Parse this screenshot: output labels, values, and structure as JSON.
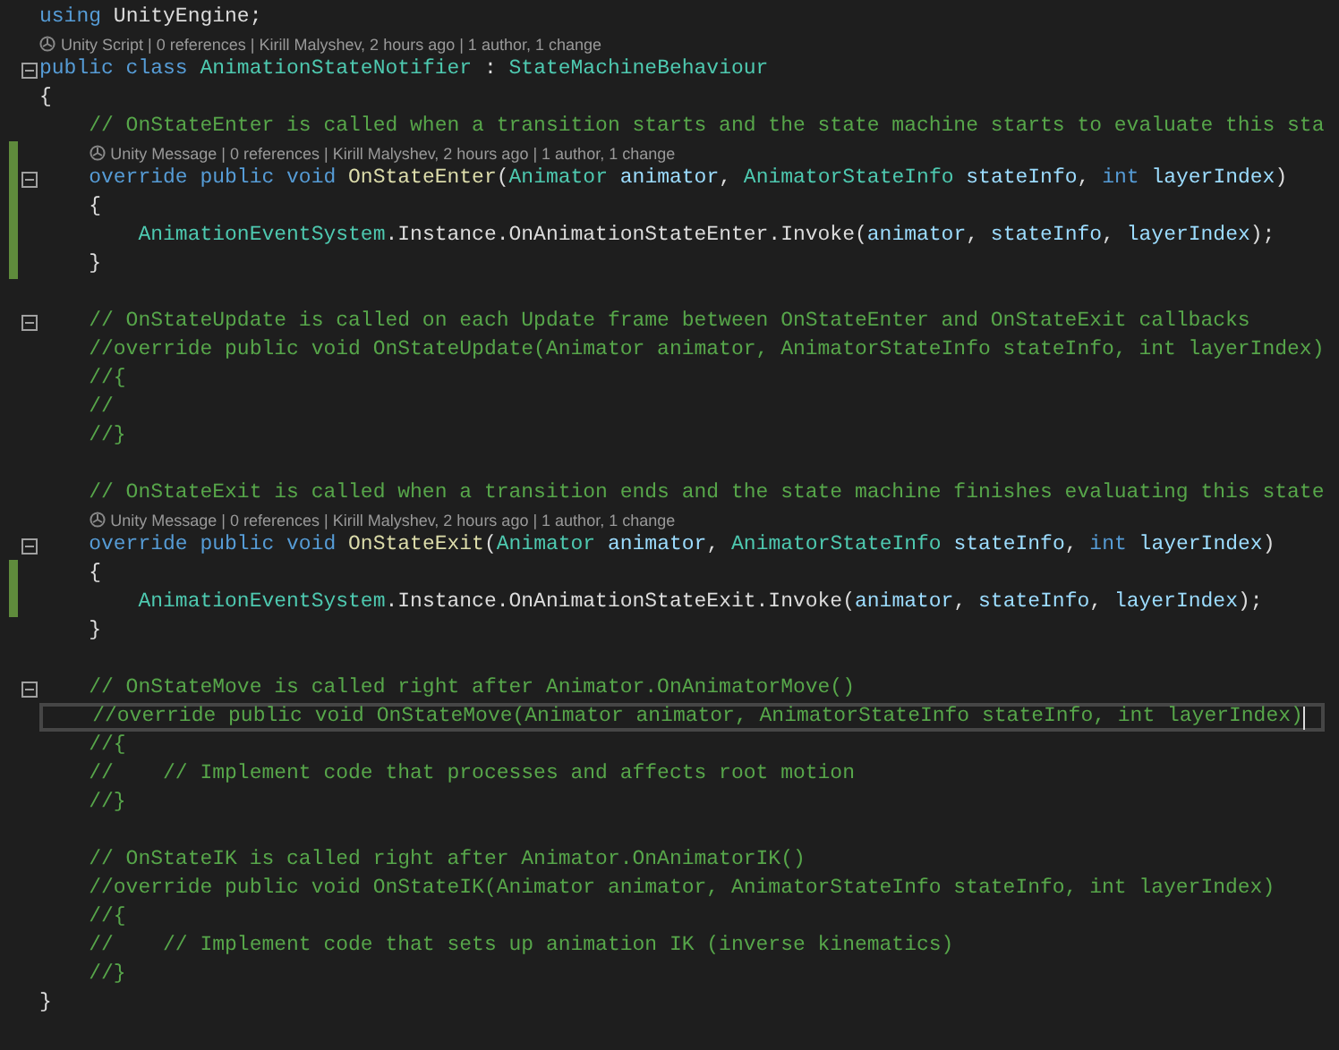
{
  "lines": [
    {
      "kind": "code",
      "tokens": [
        {
          "kind": "kw",
          "text": "using"
        },
        {
          "kind": "plain",
          "text": " UnityEngine;"
        }
      ]
    },
    {
      "kind": "lens",
      "text": "Unity Script | 0 references | Kirill Malyshev, 2 hours ago | 1 author, 1 change"
    },
    {
      "kind": "code",
      "fold": true,
      "tokens": [
        {
          "kind": "kw",
          "text": "public class "
        },
        {
          "kind": "type",
          "text": "AnimationStateNotifier"
        },
        {
          "kind": "plain",
          "text": " : "
        },
        {
          "kind": "type",
          "text": "StateMachineBehaviour"
        }
      ]
    },
    {
      "kind": "code",
      "tokens": [
        {
          "kind": "plain",
          "text": "{"
        }
      ]
    },
    {
      "kind": "code",
      "tokens": [
        {
          "kind": "comment",
          "text": "    // OnStateEnter is called when a transition starts and the state machine starts to evaluate this sta"
        }
      ]
    },
    {
      "kind": "lens",
      "changed": true,
      "text": "Unity Message | 0 references | Kirill Malyshev, 2 hours ago | 1 author, 1 change"
    },
    {
      "kind": "code",
      "fold": true,
      "changed": true,
      "tokens": [
        {
          "kind": "kw",
          "text": "    override public void "
        },
        {
          "kind": "method",
          "text": "OnStateEnter"
        },
        {
          "kind": "plain",
          "text": "("
        },
        {
          "kind": "type",
          "text": "Animator"
        },
        {
          "kind": "param",
          "text": " animator"
        },
        {
          "kind": "plain",
          "text": ", "
        },
        {
          "kind": "type",
          "text": "AnimatorStateInfo"
        },
        {
          "kind": "param",
          "text": " stateInfo"
        },
        {
          "kind": "plain",
          "text": ", "
        },
        {
          "kind": "kw",
          "text": "int"
        },
        {
          "kind": "param",
          "text": " layerIndex"
        },
        {
          "kind": "plain",
          "text": ")"
        }
      ]
    },
    {
      "kind": "code",
      "changed": true,
      "tokens": [
        {
          "kind": "plain",
          "text": "    {"
        }
      ]
    },
    {
      "kind": "code",
      "changed": true,
      "tokens": [
        {
          "kind": "type",
          "text": "        AnimationEventSystem"
        },
        {
          "kind": "plain",
          "text": ".Instance.OnAnimationStateEnter.Invoke("
        },
        {
          "kind": "param",
          "text": "animator"
        },
        {
          "kind": "plain",
          "text": ", "
        },
        {
          "kind": "param",
          "text": "stateInfo"
        },
        {
          "kind": "plain",
          "text": ", "
        },
        {
          "kind": "param",
          "text": "layerIndex"
        },
        {
          "kind": "plain",
          "text": ");"
        }
      ]
    },
    {
      "kind": "code",
      "changed": true,
      "tokens": [
        {
          "kind": "plain",
          "text": "    }"
        }
      ]
    },
    {
      "kind": "blank"
    },
    {
      "kind": "code",
      "fold": true,
      "tokens": [
        {
          "kind": "comment",
          "text": "    // OnStateUpdate is called on each Update frame between OnStateEnter and OnStateExit callbacks"
        }
      ]
    },
    {
      "kind": "code",
      "tokens": [
        {
          "kind": "comment",
          "text": "    //override public void OnStateUpdate(Animator animator, AnimatorStateInfo stateInfo, int layerIndex)"
        }
      ]
    },
    {
      "kind": "code",
      "tokens": [
        {
          "kind": "comment",
          "text": "    //{"
        }
      ]
    },
    {
      "kind": "code",
      "tokens": [
        {
          "kind": "comment",
          "text": "    //"
        }
      ]
    },
    {
      "kind": "code",
      "tokens": [
        {
          "kind": "comment",
          "text": "    //}"
        }
      ]
    },
    {
      "kind": "blank"
    },
    {
      "kind": "code",
      "tokens": [
        {
          "kind": "comment",
          "text": "    // OnStateExit is called when a transition ends and the state machine finishes evaluating this state"
        }
      ]
    },
    {
      "kind": "lens",
      "text": "Unity Message | 0 references | Kirill Malyshev, 2 hours ago | 1 author, 1 change"
    },
    {
      "kind": "code",
      "fold": true,
      "tokens": [
        {
          "kind": "kw",
          "text": "    override public void "
        },
        {
          "kind": "method",
          "text": "OnStateExit"
        },
        {
          "kind": "plain",
          "text": "("
        },
        {
          "kind": "type",
          "text": "Animator"
        },
        {
          "kind": "param",
          "text": " animator"
        },
        {
          "kind": "plain",
          "text": ", "
        },
        {
          "kind": "type",
          "text": "AnimatorStateInfo"
        },
        {
          "kind": "param",
          "text": " stateInfo"
        },
        {
          "kind": "plain",
          "text": ", "
        },
        {
          "kind": "kw",
          "text": "int"
        },
        {
          "kind": "param",
          "text": " layerIndex"
        },
        {
          "kind": "plain",
          "text": ")"
        }
      ]
    },
    {
      "kind": "code",
      "changed": true,
      "tokens": [
        {
          "kind": "plain",
          "text": "    {"
        }
      ]
    },
    {
      "kind": "code",
      "changed": true,
      "tokens": [
        {
          "kind": "type",
          "text": "        AnimationEventSystem"
        },
        {
          "kind": "plain",
          "text": ".Instance.OnAnimationStateExit.Invoke("
        },
        {
          "kind": "param",
          "text": "animator"
        },
        {
          "kind": "plain",
          "text": ", "
        },
        {
          "kind": "param",
          "text": "stateInfo"
        },
        {
          "kind": "plain",
          "text": ", "
        },
        {
          "kind": "param",
          "text": "layerIndex"
        },
        {
          "kind": "plain",
          "text": ");"
        }
      ]
    },
    {
      "kind": "code",
      "tokens": [
        {
          "kind": "plain",
          "text": "    }"
        }
      ]
    },
    {
      "kind": "blank"
    },
    {
      "kind": "code",
      "fold": true,
      "tokens": [
        {
          "kind": "comment",
          "text": "    // OnStateMove is called right after Animator.OnAnimatorMove()"
        }
      ]
    },
    {
      "kind": "code",
      "current": true,
      "tokens": [
        {
          "kind": "comment",
          "text": "    //override public void OnStateMove(Animator animator, AnimatorStateInfo stateInfo, int layerIndex)"
        }
      ]
    },
    {
      "kind": "code",
      "tokens": [
        {
          "kind": "comment",
          "text": "    //{"
        }
      ]
    },
    {
      "kind": "code",
      "tokens": [
        {
          "kind": "comment",
          "text": "    //    // Implement code that processes and affects root motion"
        }
      ]
    },
    {
      "kind": "code",
      "tokens": [
        {
          "kind": "comment",
          "text": "    //}"
        }
      ]
    },
    {
      "kind": "blank"
    },
    {
      "kind": "code",
      "tokens": [
        {
          "kind": "comment",
          "text": "    // OnStateIK is called right after Animator.OnAnimatorIK()"
        }
      ]
    },
    {
      "kind": "code",
      "tokens": [
        {
          "kind": "comment",
          "text": "    //override public void OnStateIK(Animator animator, AnimatorStateInfo stateInfo, int layerIndex)"
        }
      ]
    },
    {
      "kind": "code",
      "tokens": [
        {
          "kind": "comment",
          "text": "    //{"
        }
      ]
    },
    {
      "kind": "code",
      "tokens": [
        {
          "kind": "comment",
          "text": "    //    // Implement code that sets up animation IK (inverse kinematics)"
        }
      ]
    },
    {
      "kind": "code",
      "tokens": [
        {
          "kind": "comment",
          "text": "    //}"
        }
      ]
    },
    {
      "kind": "code",
      "tokens": [
        {
          "kind": "plain",
          "text": "}"
        }
      ]
    }
  ]
}
